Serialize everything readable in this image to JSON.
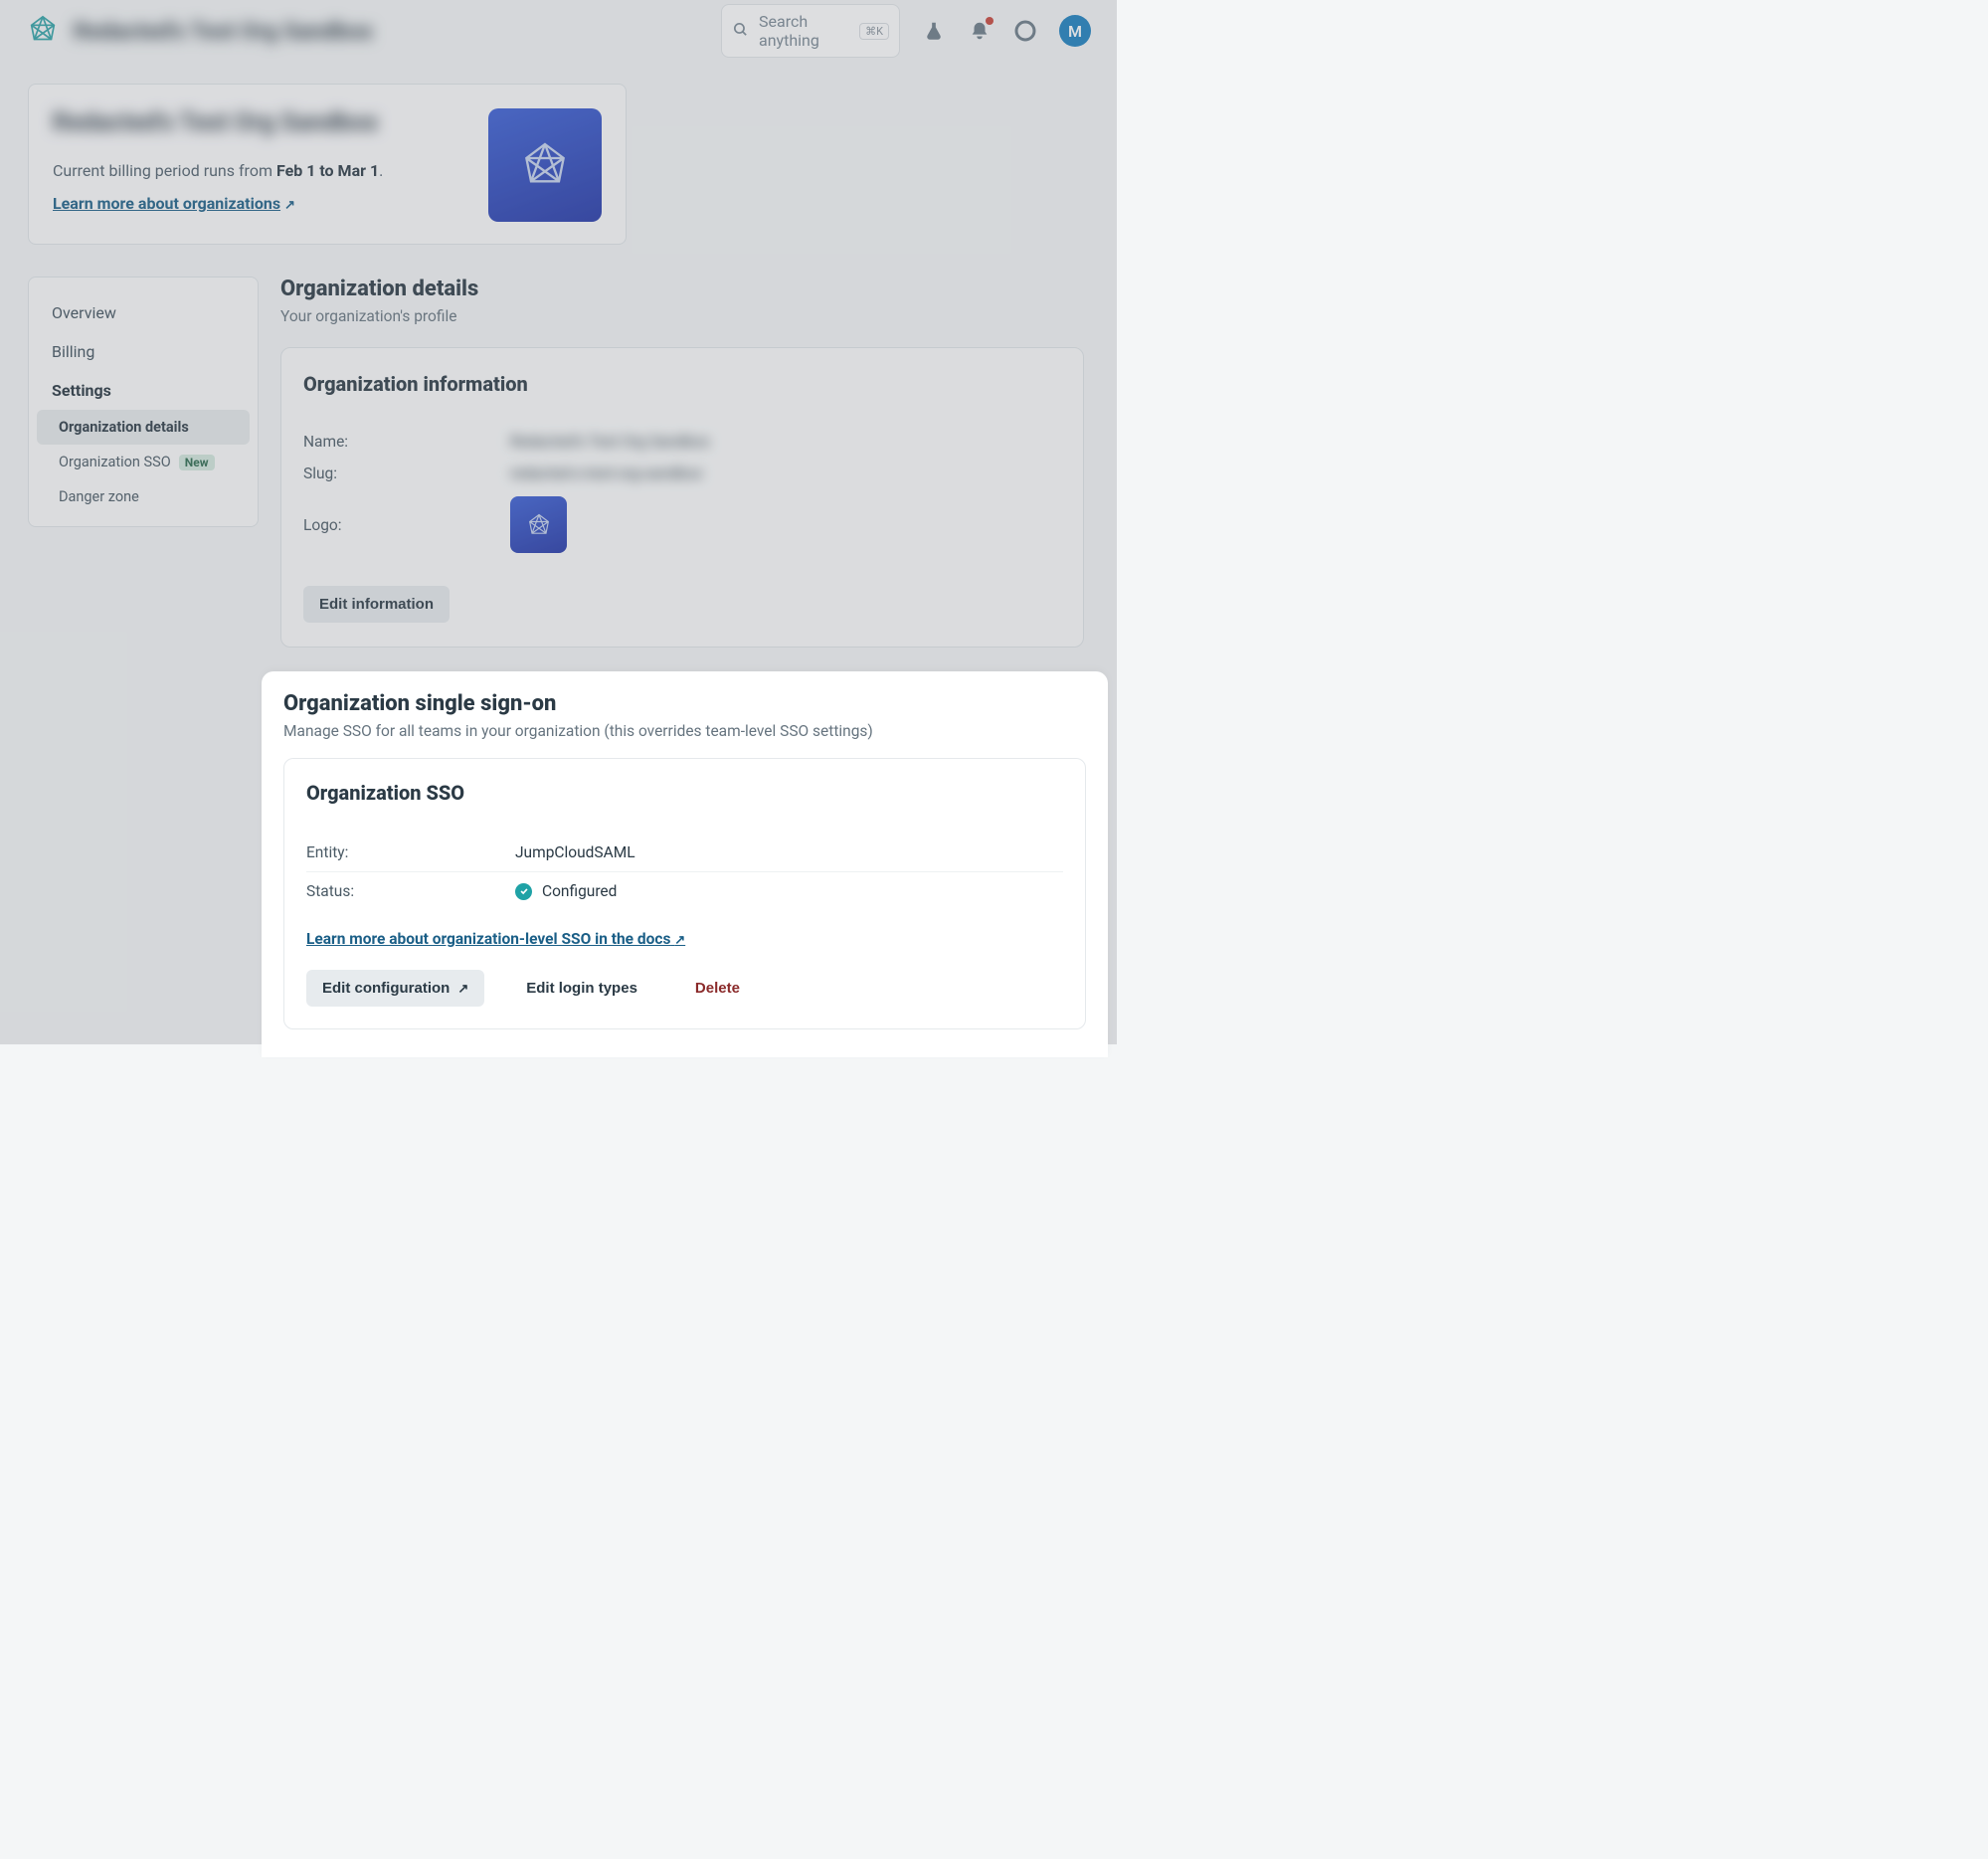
{
  "topbar": {
    "org_name": "Redacted's Test Org Sandbox",
    "search_placeholder": "Search anything",
    "search_shortcut": "⌘K",
    "avatar_initial": "M"
  },
  "header_card": {
    "title": "Redacted's Test Org Sandbox",
    "billing_prefix": "Current billing period runs from ",
    "billing_range": "Feb 1 to Mar 1",
    "billing_suffix": ".",
    "learn_link": "Learn more about organizations"
  },
  "sidebar": {
    "items": {
      "overview": "Overview",
      "billing": "Billing",
      "settings": "Settings"
    },
    "subitems": {
      "org_details": "Organization details",
      "org_sso": "Organization SSO",
      "org_sso_badge": "New",
      "danger": "Danger zone"
    }
  },
  "details_section": {
    "title": "Organization details",
    "subtitle": "Your organization's profile"
  },
  "info_card": {
    "heading": "Organization information",
    "name_label": "Name:",
    "name_value": "Redacted's Test Org Sandbox",
    "slug_label": "Slug:",
    "slug_value": "redacted-s-test-org-sandbox",
    "logo_label": "Logo:",
    "edit_button": "Edit information"
  },
  "sso_section": {
    "title": "Organization single sign-on",
    "subtitle": "Manage SSO for all teams in your organization (this overrides team-level SSO settings)",
    "card_heading": "Organization SSO",
    "entity_label": "Entity:",
    "entity_value": "JumpCloudSAML",
    "status_label": "Status:",
    "status_value": "Configured",
    "docs_link": "Learn more about organization-level SSO in the docs",
    "edit_config": "Edit configuration",
    "edit_login": "Edit login types",
    "delete": "Delete"
  }
}
